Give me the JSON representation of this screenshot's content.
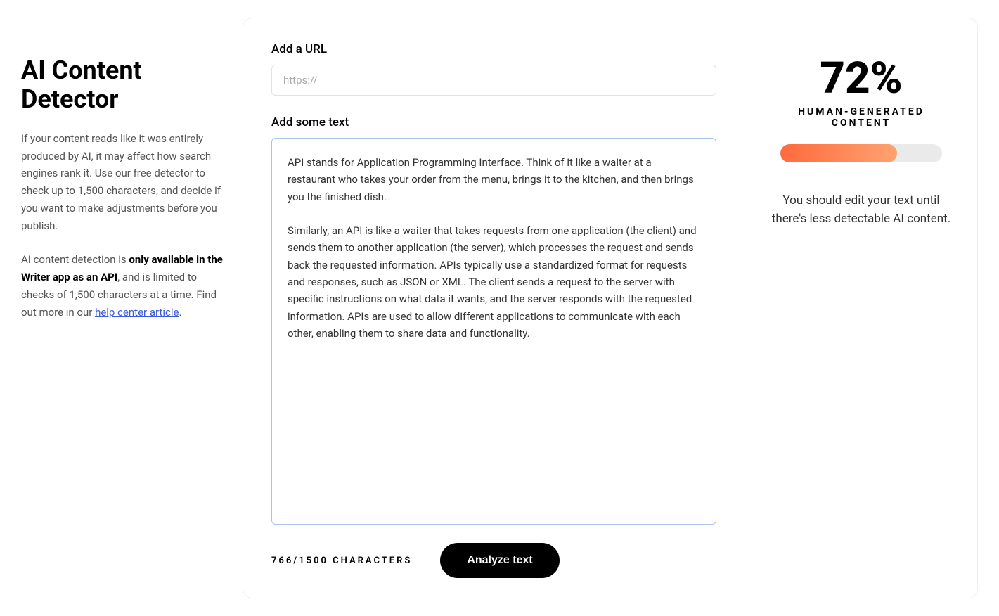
{
  "sidebar": {
    "title": "AI Content Detector",
    "desc1": "If your content reads like it was entirely produced by AI, it may affect how search engines rank it. Use our free detector to check up to 1,500 characters, and decide if you want to make adjustments before you publish.",
    "desc2_pre": "AI content detection is ",
    "desc2_bold": "only available in the Writer app as an API",
    "desc2_mid": ", and is limited to checks of 1,500 characters at a time. Find out more in our ",
    "desc2_link": "help center article",
    "desc2_post": "."
  },
  "main": {
    "url_label": "Add a URL",
    "url_placeholder": "https://",
    "text_label": "Add some text",
    "text_value": "API stands for Application Programming Interface. Think of it like a waiter at a restaurant who takes your order from the menu, brings it to the kitchen, and then brings you the finished dish.\n\nSimilarly, an API is like a waiter that takes requests from one application (the client) and sends them to another application (the server), which processes the request and sends back the requested information. APIs typically use a standardized format for requests and responses, such as JSON or XML. The client sends a request to the server with specific instructions on what data it wants, and the server responds with the requested information. APIs are used to allow different applications to communicate with each other, enabling them to share data and functionality.",
    "char_count": "766/1500 CHARACTERS",
    "analyze_label": "Analyze text"
  },
  "result": {
    "score_text": "72%",
    "score_percent": 72,
    "score_label": "HUMAN-GENERATED CONTENT",
    "advice": "You should edit your text until there's less detectable AI content."
  }
}
